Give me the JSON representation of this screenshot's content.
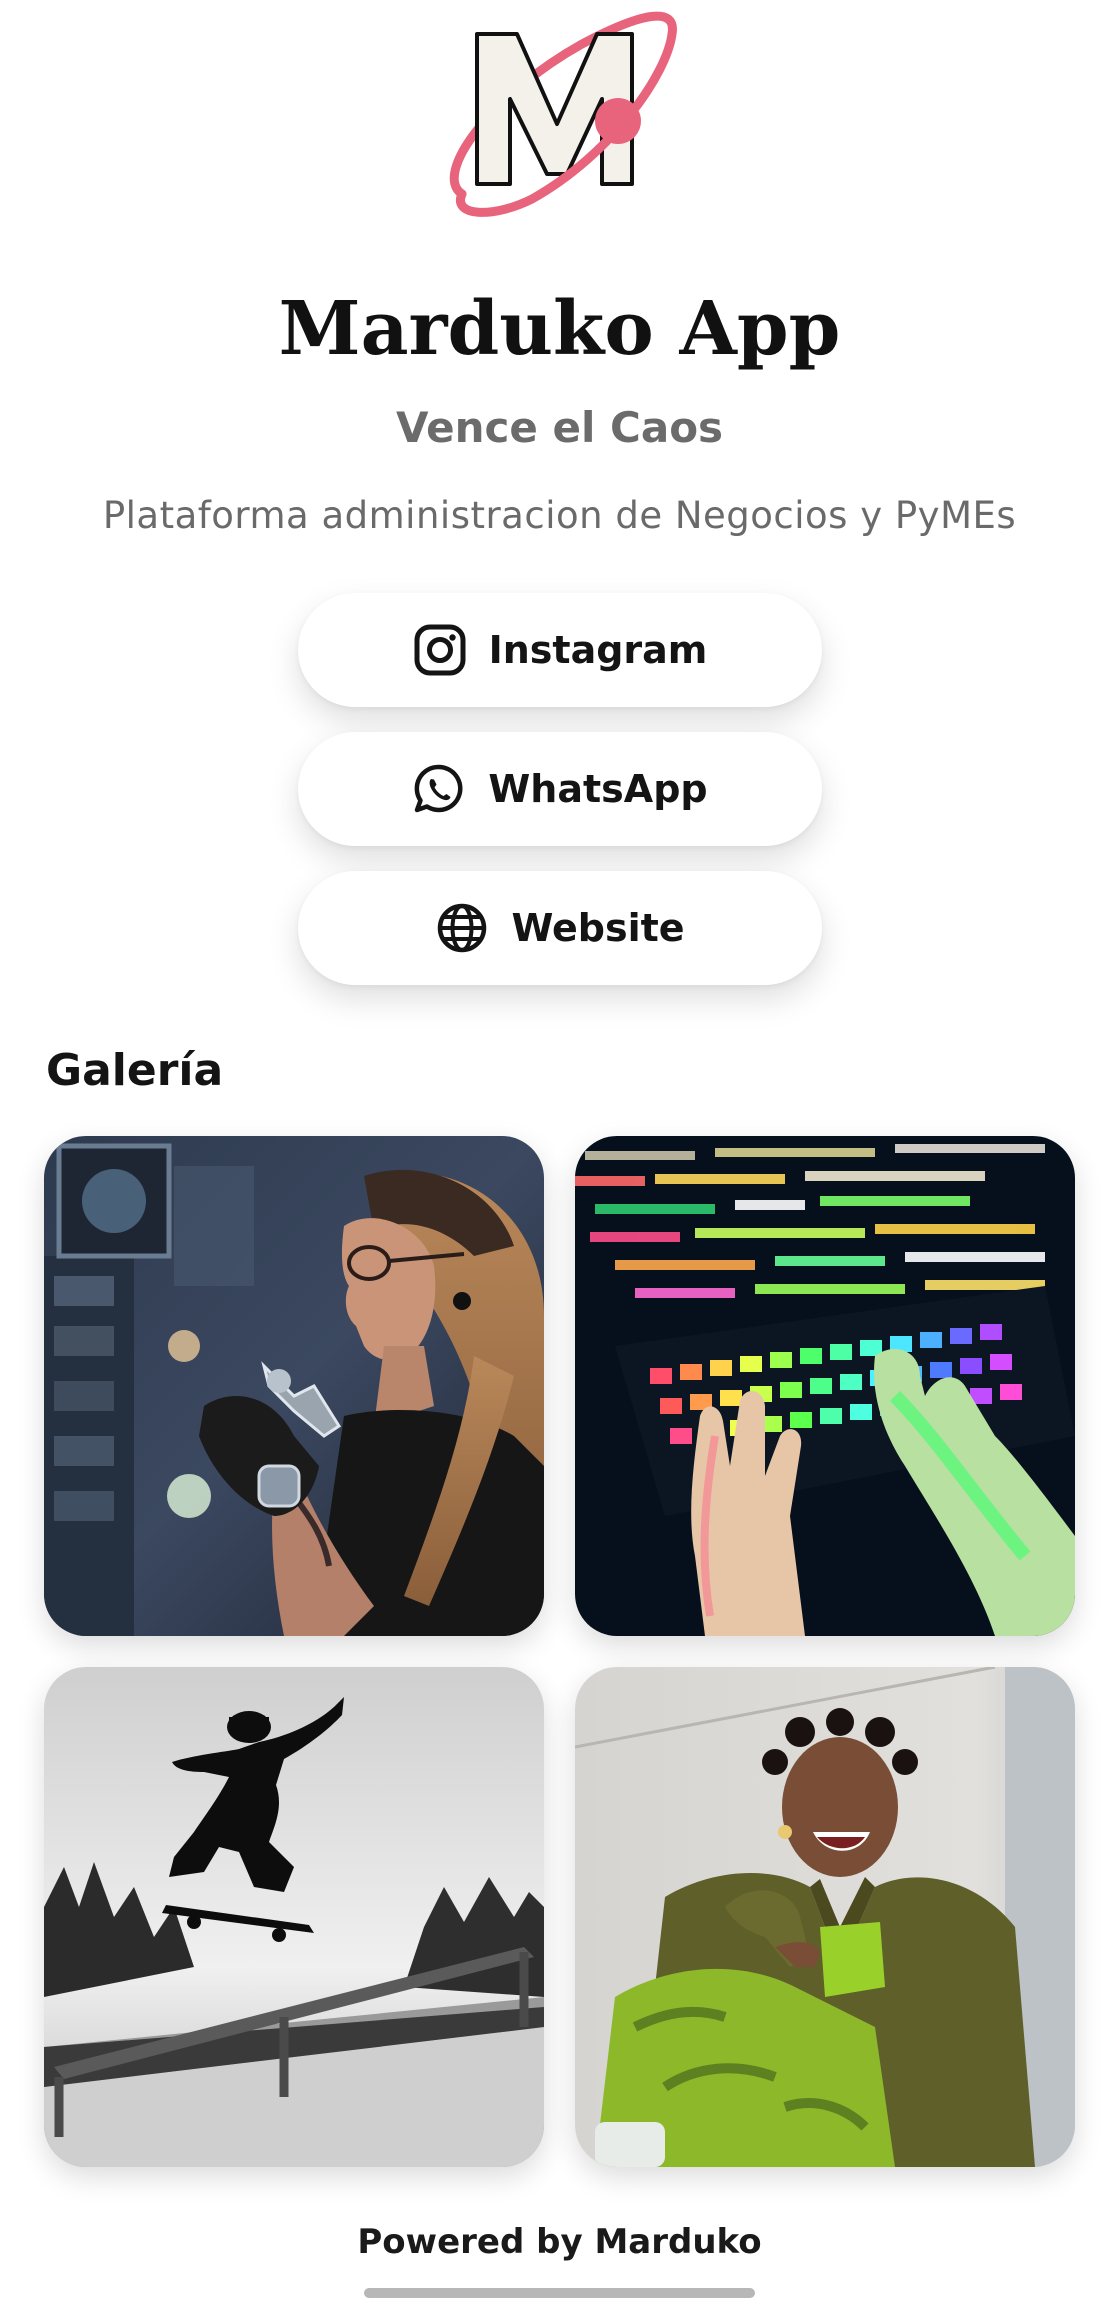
{
  "profile": {
    "title": "Marduko App",
    "tagline": "Vence el Caos",
    "description": "Plataforma administracion de Negocios y PyMEs",
    "logo_letter": "M"
  },
  "links": [
    {
      "label": "Instagram",
      "icon": "instagram-icon"
    },
    {
      "label": "WhatsApp",
      "icon": "whatsapp-icon"
    },
    {
      "label": "Website",
      "icon": "globe-icon"
    }
  ],
  "gallery": {
    "title": "Galería",
    "images": [
      {
        "subject": "tattoo-artist-photo"
      },
      {
        "subject": "rgb-keyboard-code-photo"
      },
      {
        "subject": "skateboarder-photo"
      },
      {
        "subject": "laughing-woman-photo"
      }
    ]
  },
  "footer": {
    "text": "Powered by Marduko"
  },
  "colors": {
    "accent": "#e8647c",
    "title": "#111111",
    "muted": "#6b6b6b",
    "logo_fill": "#f3f1ea"
  }
}
